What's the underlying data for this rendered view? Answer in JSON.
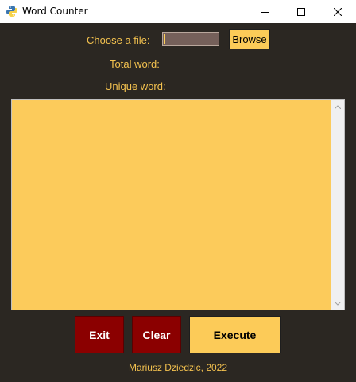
{
  "window": {
    "title": "Word Counter",
    "app_icon": "python-icon",
    "controls": [
      "minimize-icon",
      "maximize-icon",
      "close-icon"
    ]
  },
  "form": {
    "choose_file_label": "Choose a file:",
    "file_value": "",
    "browse_label": "Browse",
    "total_word_label": "Total word:",
    "total_word_value": "",
    "unique_word_label": "Unique word:",
    "unique_word_value": ""
  },
  "output": {
    "text": ""
  },
  "buttons": {
    "exit_label": "Exit",
    "clear_label": "Clear",
    "execute_label": "Execute"
  },
  "footer": {
    "credit": "Mariusz Dziedzic, 2022"
  },
  "colors": {
    "background": "#2b2722",
    "label": "#f4c24f",
    "text_area": "#fccb5b",
    "exit_clear": "#8b0000",
    "execute_browse": "#fccb58"
  }
}
